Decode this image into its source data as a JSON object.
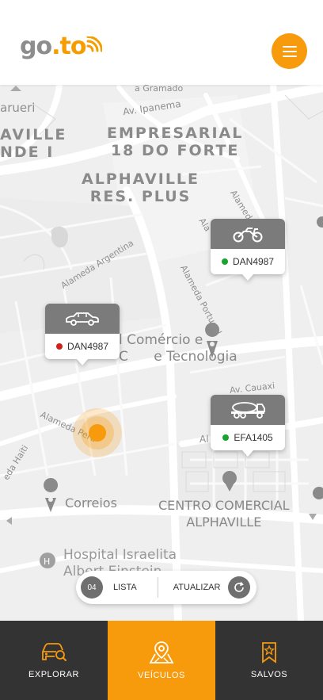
{
  "header": {
    "logo_main": "go",
    "logo_dot": ".",
    "logo_end": "to",
    "menu_icon": "hamburger-icon",
    "accent_color": "#f79a0c"
  },
  "map": {
    "areas": [
      {
        "line1": "EMPRESARIAL",
        "line2": "18 DO FORTE"
      },
      {
        "line1": "ALPHAVILLE",
        "line2": "RES. PLUS"
      },
      {
        "line1": "AVILLE",
        "line2": "NDE I"
      }
    ],
    "streets": {
      "gramado": "a Gramado",
      "ipanema": "Av. Ipanema",
      "barueri": "arueri",
      "argentina": "Alameda Argentina",
      "portugal": "Alameda Portugal",
      "alameda_right": "Alameda",
      "alameda_right2": "Ala",
      "cauaxi": "Av. Cauaxi",
      "peru": "Alameda Peru",
      "haiti": "eda Haiti",
      "al": "Al"
    },
    "pois": {
      "comercio_line1": "l Comércio e",
      "comercio_line2": "C      e Tecnologia",
      "correios": "Correios",
      "centro_line1": "CENTRO COMERCIAL",
      "centro_line2": "ALPHAVILLE",
      "hospital_line1": "Hospital Israelita",
      "hospital_line2": "Albert Einstein"
    }
  },
  "vehicles": [
    {
      "type": "motorcycle-icon",
      "plate": "DAN4987",
      "status_color": "#1aa32f"
    },
    {
      "type": "car-icon",
      "plate": "DAN4987",
      "status_color": "#d0211b"
    },
    {
      "type": "truck-icon",
      "plate": "EFA1405",
      "status_color": "#1aa32f"
    }
  ],
  "toolbar": {
    "count": "04",
    "list_label": "LISTA",
    "refresh_label": "ATUALIZAR",
    "refresh_icon": "refresh-icon"
  },
  "bottom_nav": [
    {
      "label": "EXPLORAR",
      "icon": "car-search-icon",
      "active": false
    },
    {
      "label": "VEÍCULOS",
      "icon": "map-pin-icon",
      "active": true
    },
    {
      "label": "SALVOS",
      "icon": "bookmark-star-icon",
      "active": false
    }
  ]
}
